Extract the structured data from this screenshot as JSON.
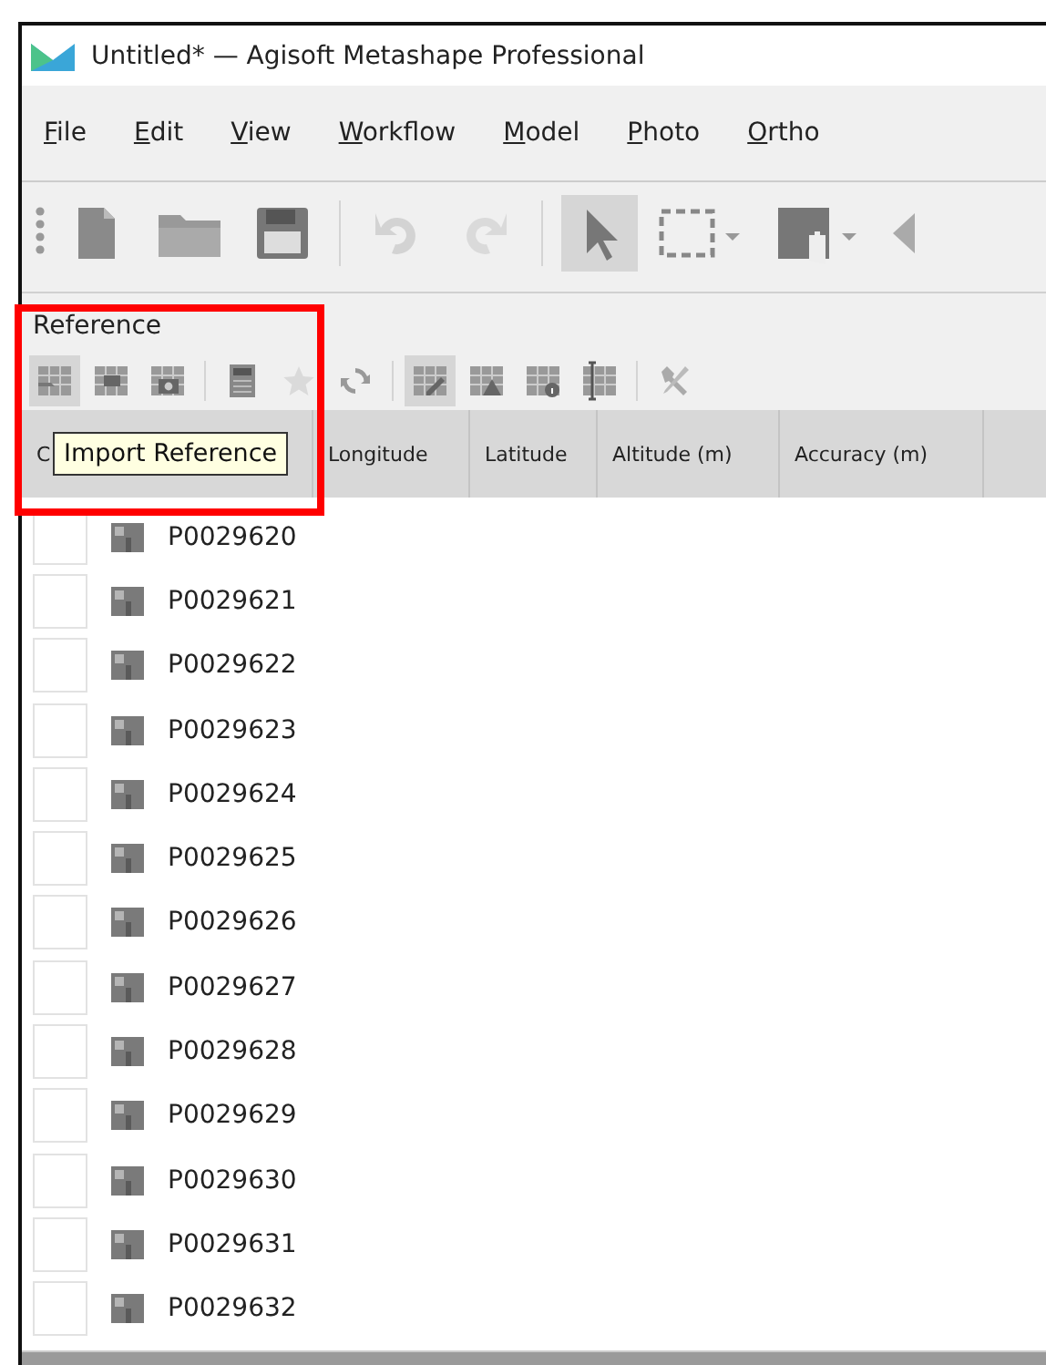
{
  "window": {
    "title": "Untitled* — Agisoft Metashape Professional"
  },
  "menu": [
    "File",
    "Edit",
    "View",
    "Workflow",
    "Model",
    "Photo",
    "Ortho"
  ],
  "toolbar": [
    {
      "kind": "new",
      "selected": false,
      "disabled": false
    },
    {
      "kind": "open",
      "selected": false,
      "disabled": false
    },
    {
      "kind": "save",
      "selected": false,
      "disabled": false
    },
    {
      "kind": "separator"
    },
    {
      "kind": "undo",
      "selected": false,
      "disabled": true
    },
    {
      "kind": "redo",
      "selected": false,
      "disabled": true
    },
    {
      "kind": "separator"
    },
    {
      "kind": "pointer",
      "selected": true,
      "disabled": false
    },
    {
      "kind": "rect-select",
      "selected": false,
      "disabled": false
    },
    {
      "kind": "navigate",
      "selected": false,
      "disabled": false
    },
    {
      "kind": "partial",
      "selected": false,
      "disabled": false
    }
  ],
  "reference_panel": {
    "title": "Reference",
    "toolbar": [
      {
        "kind": "import",
        "selected": true,
        "disabled": false
      },
      {
        "kind": "export",
        "selected": false,
        "disabled": false
      },
      {
        "kind": "camera-table",
        "selected": false,
        "disabled": false
      },
      {
        "kind": "separator"
      },
      {
        "kind": "calculator",
        "selected": false,
        "disabled": false
      },
      {
        "kind": "star",
        "selected": false,
        "disabled": true
      },
      {
        "kind": "refresh",
        "selected": false,
        "disabled": false
      },
      {
        "kind": "separator"
      },
      {
        "kind": "edit-table",
        "selected": true,
        "disabled": false
      },
      {
        "kind": "warning-table",
        "selected": false,
        "disabled": false
      },
      {
        "kind": "info-table",
        "selected": false,
        "disabled": false
      },
      {
        "kind": "cursor-table",
        "selected": false,
        "disabled": false
      },
      {
        "kind": "separator"
      },
      {
        "kind": "tools",
        "selected": false,
        "disabled": false
      }
    ],
    "tooltip": "Import Reference",
    "columns": [
      "C",
      "Longitude",
      "Latitude",
      "Altitude (m)",
      "Accuracy (m)"
    ],
    "rows": [
      {
        "name": "P0029620",
        "checked": false
      },
      {
        "name": "P0029621",
        "checked": false
      },
      {
        "name": "P0029622",
        "checked": false
      },
      {
        "name": "P0029623",
        "checked": false
      },
      {
        "name": "P0029624",
        "checked": false
      },
      {
        "name": "P0029625",
        "checked": false
      },
      {
        "name": "P0029626",
        "checked": false
      },
      {
        "name": "P0029627",
        "checked": false
      },
      {
        "name": "P0029628",
        "checked": false
      },
      {
        "name": "P0029629",
        "checked": false
      },
      {
        "name": "P0029630",
        "checked": false
      },
      {
        "name": "P0029631",
        "checked": false
      },
      {
        "name": "P0029632",
        "checked": false
      }
    ]
  },
  "highlight": {
    "color": "#ff0000"
  }
}
